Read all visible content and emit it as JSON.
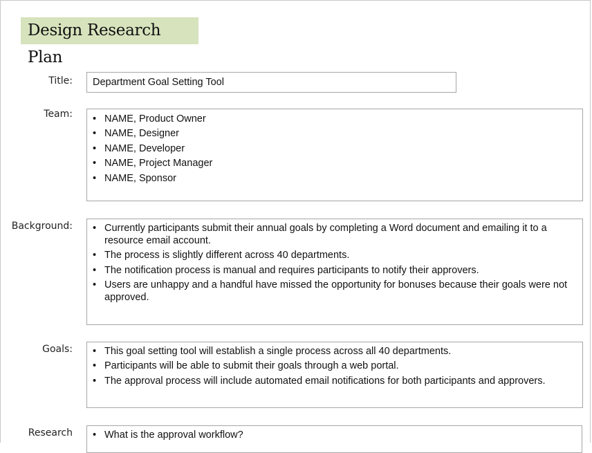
{
  "document": {
    "title": "Design Research Plan"
  },
  "fields": {
    "title": {
      "label": "Title:",
      "value": "Department Goal Setting Tool"
    },
    "team": {
      "label": "Team:",
      "items": [
        "NAME, Product Owner",
        "NAME, Designer",
        "NAME, Developer",
        "NAME, Project Manager",
        "NAME, Sponsor"
      ]
    },
    "background": {
      "label": "Background:",
      "items": [
        "Currently participants submit their annual goals by completing a Word document and emailing it to a resource email account.",
        "The process is slightly different across 40 departments.",
        "The notification process is manual and requires participants to notify their approvers.",
        "Users are unhappy and a handful have missed the opportunity for bonuses because their goals were not approved."
      ]
    },
    "goals": {
      "label": "Goals:",
      "items": [
        "This goal setting tool will establish a single process across all 40 departments.",
        "Participants will be able to submit their goals through a web portal.",
        "The approval process will include automated email notifications for both participants and approvers."
      ]
    },
    "research": {
      "label": "Research",
      "items": [
        "What is the approval workflow?"
      ]
    }
  }
}
